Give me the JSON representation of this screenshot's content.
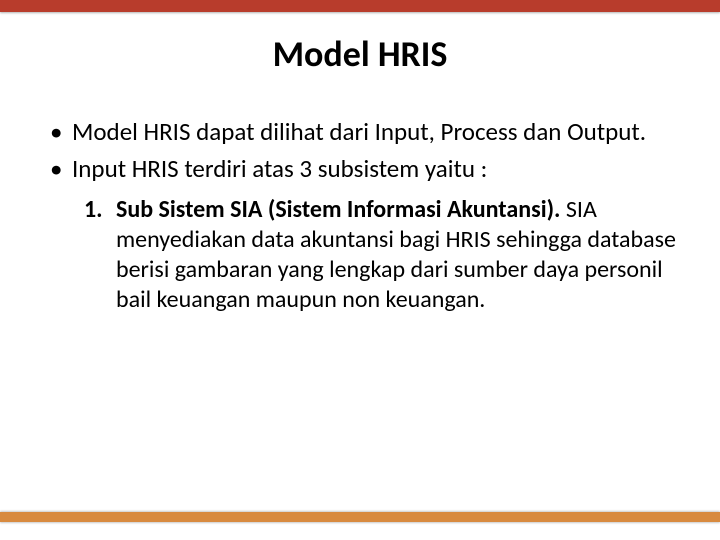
{
  "slide": {
    "title": "Model HRIS",
    "bullets": [
      "Model HRIS dapat dilihat dari Input, Process dan Output.",
      "Input HRIS terdiri atas 3 subsistem yaitu :"
    ],
    "numbered": {
      "title": "Sub Sistem SIA (Sistem Informasi Akuntansi).",
      "body": " SIA menyediakan data akuntansi bagi HRIS sehingga database berisi gambaran yang lengkap dari sumber daya personil bail keuangan maupun non keuangan."
    }
  }
}
